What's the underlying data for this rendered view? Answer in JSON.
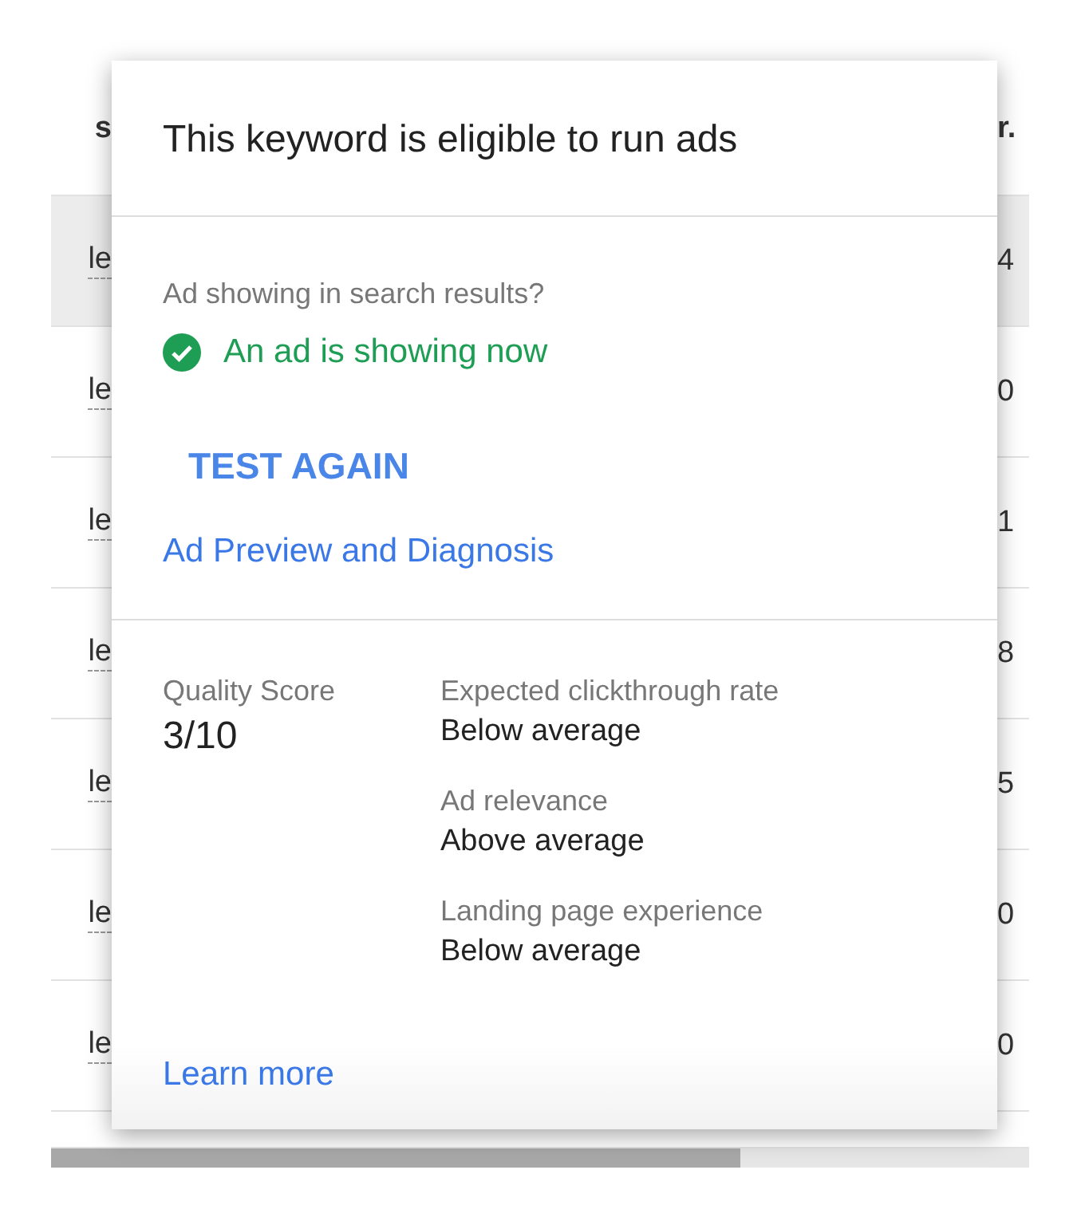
{
  "table": {
    "columns": [
      {
        "label": "s"
      },
      {
        "label": "r."
      }
    ],
    "rows": [
      {
        "cells": [
          "le",
          "4"
        ],
        "selected": true
      },
      {
        "cells": [
          "le",
          "0"
        ],
        "selected": false
      },
      {
        "cells": [
          "le",
          "1"
        ],
        "selected": false
      },
      {
        "cells": [
          "le",
          "8"
        ],
        "selected": false
      },
      {
        "cells": [
          "le",
          "5"
        ],
        "selected": false
      },
      {
        "cells": [
          "le",
          "0"
        ],
        "selected": false
      },
      {
        "cells": [
          "le",
          "0"
        ],
        "selected": false
      }
    ]
  },
  "popover": {
    "title": "This keyword is eligible to run ads",
    "ad_status": {
      "question": "Ad showing in search results?",
      "showing": true,
      "result": "An ad is showing now"
    },
    "test_button": "TEST AGAIN",
    "diagnosis_link": "Ad Preview and Diagnosis",
    "quality_score": {
      "label": "Quality Score",
      "value": "3/10"
    },
    "factors": [
      {
        "label": "Expected clickthrough rate",
        "value": "Below average"
      },
      {
        "label": "Ad relevance",
        "value": "Above average"
      },
      {
        "label": "Landing page experience",
        "value": "Below average"
      }
    ],
    "learn_more": "Learn more"
  }
}
